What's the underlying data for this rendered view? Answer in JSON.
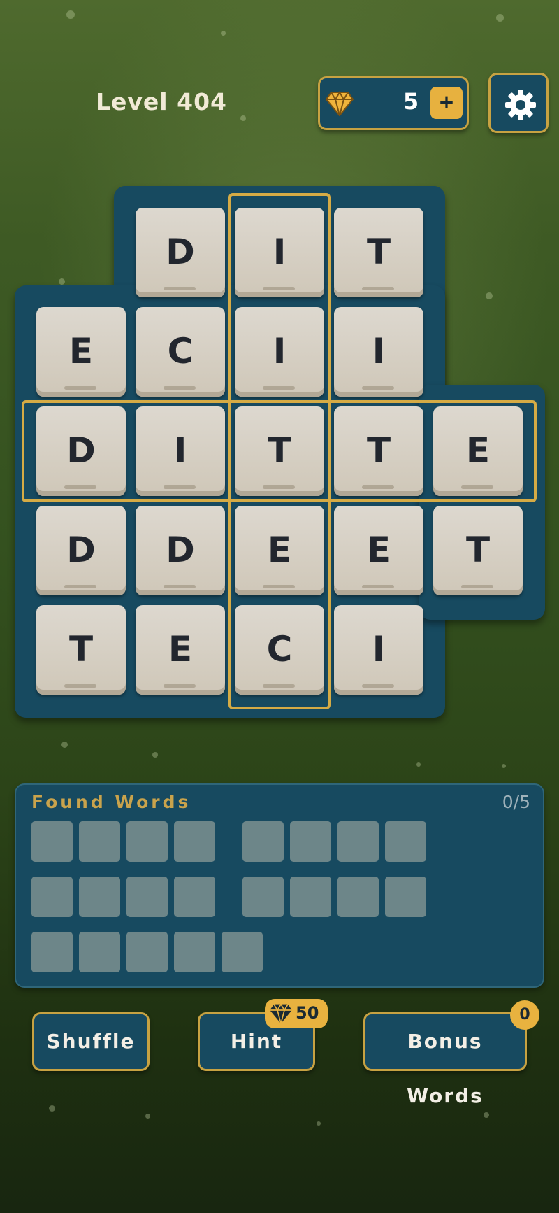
{
  "header": {
    "level_label": "Level 404",
    "gem_count": "5",
    "add_gems_label": "+",
    "settings_icon": "gear-icon"
  },
  "board": {
    "rows": [
      [
        "",
        "D",
        "I",
        "T",
        ""
      ],
      [
        "E",
        "C",
        "I",
        "I",
        ""
      ],
      [
        "D",
        "I",
        "T",
        "T",
        "E"
      ],
      [
        "D",
        "D",
        "E",
        "E",
        "T"
      ],
      [
        "T",
        "E",
        "C",
        "I",
        ""
      ]
    ],
    "highlighted_row": 2,
    "highlighted_column": 2
  },
  "found_words": {
    "title": "Found Words",
    "progress": "0/5",
    "found": 0,
    "total": 5,
    "word_lengths": [
      4,
      4,
      4,
      4,
      5
    ]
  },
  "actions": {
    "shuffle_label": "Shuffle",
    "hint_label": "Hint",
    "hint_cost": "50",
    "bonus_label": "Bonus Words",
    "bonus_count": "0"
  },
  "colors": {
    "accent_gold": "#c7a242",
    "panel_blue": "#174a60",
    "tile_cream": "#d8d2c7"
  }
}
